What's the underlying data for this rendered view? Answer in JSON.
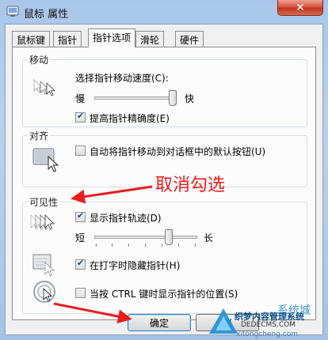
{
  "window": {
    "title": "鼠标 属性",
    "close_label": "✕"
  },
  "tabs": [
    {
      "label": "鼠标键",
      "active": false
    },
    {
      "label": "指针",
      "active": false
    },
    {
      "label": "指针选项",
      "active": true
    },
    {
      "label": "滑轮",
      "active": false
    },
    {
      "label": "硬件",
      "active": false
    }
  ],
  "motion": {
    "title": "移动",
    "speed_label": "选择指针移动速度(C):",
    "slow_label": "慢",
    "fast_label": "快",
    "speed_level": 0.95,
    "precision_label": "提高指针精确度(E)",
    "precision_checked": true
  },
  "snap": {
    "title": "对齐",
    "snap_label": "自动将指针移动到对话框中的默认按钮(U)",
    "snap_checked": false
  },
  "visibility": {
    "title": "可见性",
    "trails_label": "显示指针轨迹(D)",
    "trails_checked": true,
    "short_label": "短",
    "long_label": "长",
    "trail_level": 0.72,
    "hide_label": "在打字时隐藏指针(H)",
    "hide_checked": true,
    "ctrl_label": "当按 CTRL 键时显示指针的位置(S)",
    "ctrl_checked": false
  },
  "annotation": {
    "text": "取消勾选",
    "color": "#e81d1d"
  },
  "buttons": {
    "ok_label": "确定",
    "cancel_label": "消"
  },
  "watermark": {
    "line1": "织梦内容管理系统",
    "line2": "DEDECMS.COM",
    "line3": "系统城",
    "line4": "xitongcheng.com"
  }
}
